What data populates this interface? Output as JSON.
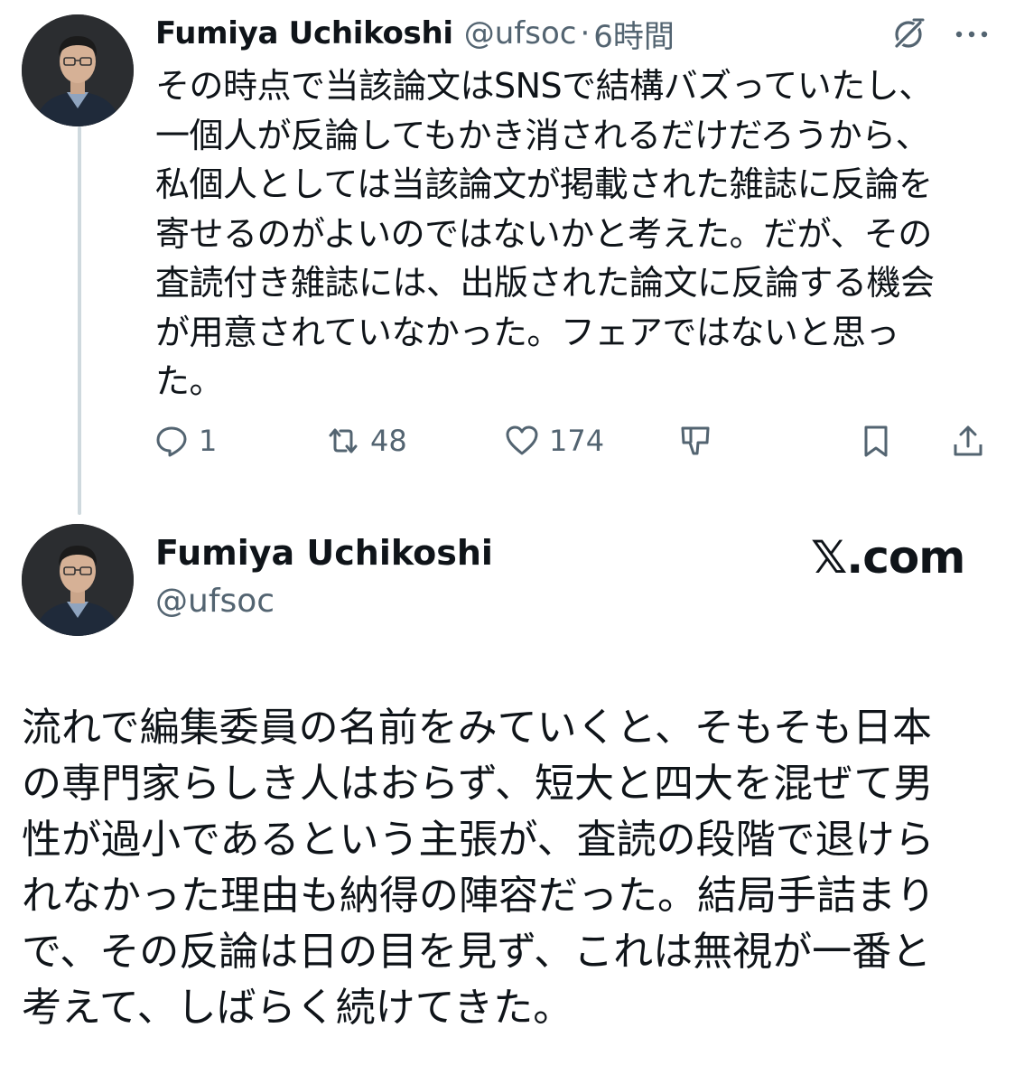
{
  "tweet1": {
    "display_name": "Fumiya Uchikoshi",
    "handle": "@ufsoc",
    "separator": "·",
    "time": "6時間",
    "text": "その時点で当該論文はSNSで結構バズっていたし、\n一個人が反論してもかき消されるだけだろうから、\n私個人としては当該論文が掲載された雑誌に反論を\n寄せるのがよいのではないかと考えた。だが、その\n査読付き雑誌には、出版された論文に反論する機会\nが用意されていなかった。フェアではないと思っ\nた。",
    "actions": {
      "reply_count": "1",
      "retweet_count": "48",
      "like_count": "174"
    },
    "icons": [
      "grok-icon",
      "more-icon",
      "reply-icon",
      "retweet-icon",
      "like-icon",
      "dislike-icon",
      "bookmark-icon",
      "share-icon"
    ]
  },
  "tweet2": {
    "display_name": "Fumiya Uchikoshi",
    "handle": "@ufsoc",
    "brand": "𝕏.com",
    "text": "流れで編集委員の名前をみていくと、そもそも日本\nの専門家らしき人はおらず、短大と四大を混ぜて男\n性が過小であるという主張が、査読の段階で退けら\nれなかった理由も納得の陣容だった。結局手詰まり\nで、その反論は日の目を見ず、これは無視が一番と\n考えて、しばらく続けてきた。"
  },
  "colors": {
    "text_primary": "#0f1419",
    "text_secondary": "#536471",
    "thread_line": "#cfd9de",
    "background": "#ffffff"
  }
}
